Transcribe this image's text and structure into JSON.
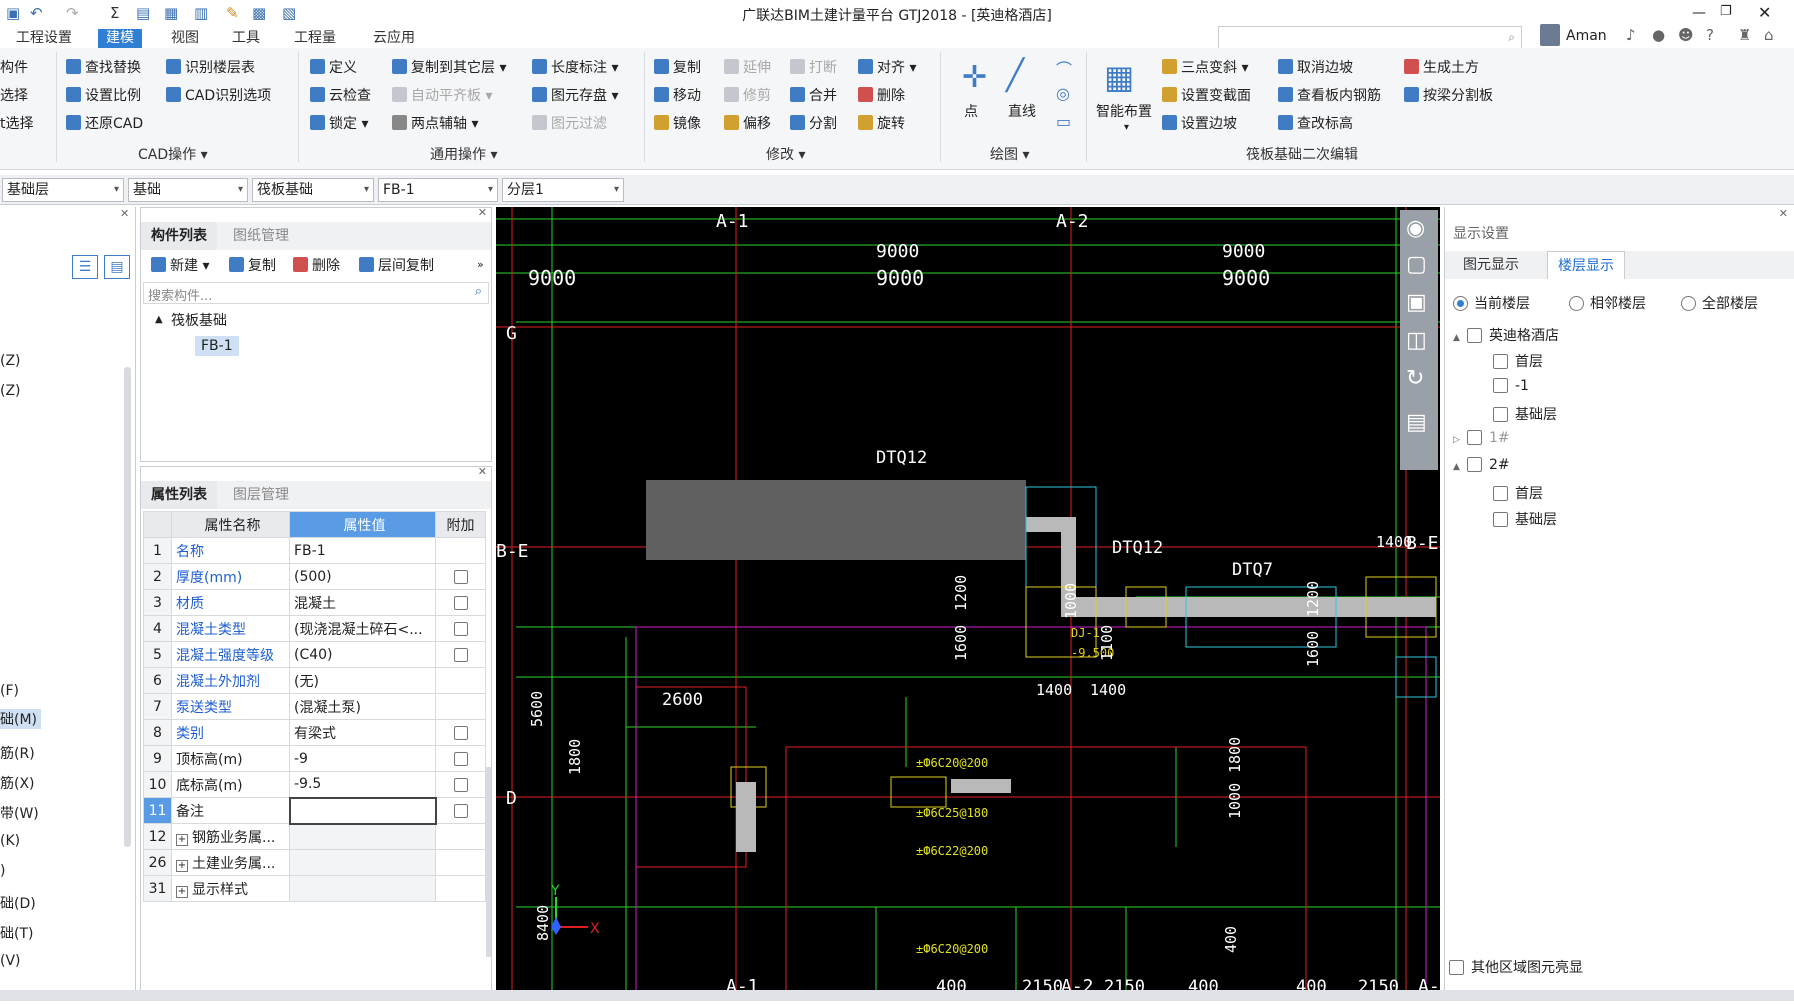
{
  "app": {
    "title": "广联达BIM土建计量平台 GTJ2018 - [英迪格酒店]",
    "user": "Aman"
  },
  "menu": [
    "工程设置",
    "建模",
    "视图",
    "工具",
    "工程量",
    "云应用"
  ],
  "ribbon": {
    "left_frag": [
      "构件",
      "选择",
      "t选择"
    ],
    "cad": {
      "items": [
        "查找替换",
        "识别楼层表",
        "设置比例",
        "CAD识别选项",
        "还原CAD"
      ],
      "group": "CAD操作"
    },
    "general": {
      "items": [
        "定义",
        "复制到其它层",
        "长度标注",
        "云检查",
        "自动平齐板",
        "图元存盘",
        "锁定",
        "两点辅轴",
        "图元过滤"
      ],
      "group": "通用操作"
    },
    "modify": {
      "items": [
        "复制",
        "延伸",
        "打断",
        "对齐",
        "移动",
        "修剪",
        "合并",
        "删除",
        "镜像",
        "偏移",
        "分割",
        "旋转"
      ],
      "group": "修改"
    },
    "draw": {
      "items": [
        "点",
        "直线"
      ],
      "group": "绘图"
    },
    "raft": {
      "items": [
        "智能布置",
        "三点变斜",
        "取消边坡",
        "生成土方",
        "设置变截面",
        "查看板内钢筋",
        "按梁分割板",
        "设置边坡",
        "查改标高"
      ],
      "group": "筏板基础二次编辑"
    }
  },
  "selectors": [
    "基础层",
    "基础",
    "筏板基础",
    "FB-1",
    "分层1"
  ],
  "left_items": [
    "(Z)",
    "(Z)",
    "(F)",
    "础(M)",
    "筋(R)",
    "筋(X)",
    "带(W)",
    "(K)",
    ")",
    "础(D)",
    "础(T)",
    "(V)"
  ],
  "component_panel": {
    "tabs": [
      "构件列表",
      "图纸管理"
    ],
    "toolbar": [
      "新建",
      "复制",
      "删除",
      "层间复制"
    ],
    "search_placeholder": "搜索构件...",
    "tree_root": "筏板基础",
    "tree_item": "FB-1"
  },
  "property_panel": {
    "tabs": [
      "属性列表",
      "图层管理"
    ],
    "headers": [
      "属性名称",
      "属性值",
      "附加"
    ],
    "rows": [
      {
        "n": "1",
        "k": "名称",
        "v": "FB-1",
        "blue": true,
        "cb": false
      },
      {
        "n": "2",
        "k": "厚度(mm)",
        "v": "(500)",
        "blue": true,
        "cb": true
      },
      {
        "n": "3",
        "k": "材质",
        "v": "混凝土",
        "blue": true,
        "cb": true
      },
      {
        "n": "4",
        "k": "混凝土类型",
        "v": "(现浇混凝土碎石<...",
        "blue": true,
        "cb": true
      },
      {
        "n": "5",
        "k": "混凝土强度等级",
        "v": "(C40)",
        "blue": true,
        "cb": true
      },
      {
        "n": "6",
        "k": "混凝土外加剂",
        "v": "(无)",
        "blue": true,
        "cb": false
      },
      {
        "n": "7",
        "k": "泵送类型",
        "v": "(混凝土泵)",
        "blue": true,
        "cb": false
      },
      {
        "n": "8",
        "k": "类别",
        "v": "有梁式",
        "blue": true,
        "cb": true
      },
      {
        "n": "9",
        "k": "顶标高(m)",
        "v": "-9",
        "blue": false,
        "cb": true
      },
      {
        "n": "10",
        "k": "底标高(m)",
        "v": "-9.5",
        "blue": false,
        "cb": true
      },
      {
        "n": "11",
        "k": "备注",
        "v": "",
        "blue": false,
        "cb": true
      },
      {
        "n": "12",
        "k": "钢筋业务属...",
        "v": "",
        "blue": false,
        "cb": false
      },
      {
        "n": "26",
        "k": "土建业务属...",
        "v": "",
        "blue": false,
        "cb": false
      },
      {
        "n": "31",
        "k": "显示样式",
        "v": "",
        "blue": false,
        "cb": false
      }
    ]
  },
  "canvas": {
    "axes": [
      "A-1",
      "A-2",
      "G",
      "B-E",
      "D",
      "A-1",
      "A-2",
      "A-",
      "B-E"
    ],
    "dims": [
      "9000",
      "9000",
      "9000",
      "9000",
      "9000",
      "2600",
      "1400",
      "1400",
      "1400",
      "5600",
      "1800",
      "1600",
      "1200",
      "1000",
      "1100",
      "1200",
      "1600",
      "1800",
      "1000",
      "400",
      "2150",
      "2150",
      "400",
      "400",
      "2150",
      "8400",
      "400"
    ],
    "labels": [
      "DTQ12",
      "DTQ12",
      "DTQ7",
      "DJ-1",
      "-9.500",
      "±Ф6C20@200",
      "±Ф6C25@180",
      "±Ф6C22@200",
      "±Ф6C20@200"
    ]
  },
  "right_panel": {
    "title": "显示设置",
    "tabs": [
      "图元显示",
      "楼层显示"
    ],
    "radios": [
      "当前楼层",
      "相邻楼层",
      "全部楼层"
    ],
    "tree": [
      {
        "label": "英迪格酒店",
        "lvl": 0,
        "exp": "▲"
      },
      {
        "label": "首层",
        "lvl": 1
      },
      {
        "label": "-1",
        "lvl": 1
      },
      {
        "label": "基础层",
        "lvl": 1
      },
      {
        "label": "1#",
        "lvl": 0,
        "exp": "▷",
        "dim": true
      },
      {
        "label": "2#",
        "lvl": 0,
        "exp": "▲"
      },
      {
        "label": "首层",
        "lvl": 1
      },
      {
        "label": "基础层",
        "lvl": 1
      }
    ],
    "bottom_check": "其他区域图元亮显"
  }
}
